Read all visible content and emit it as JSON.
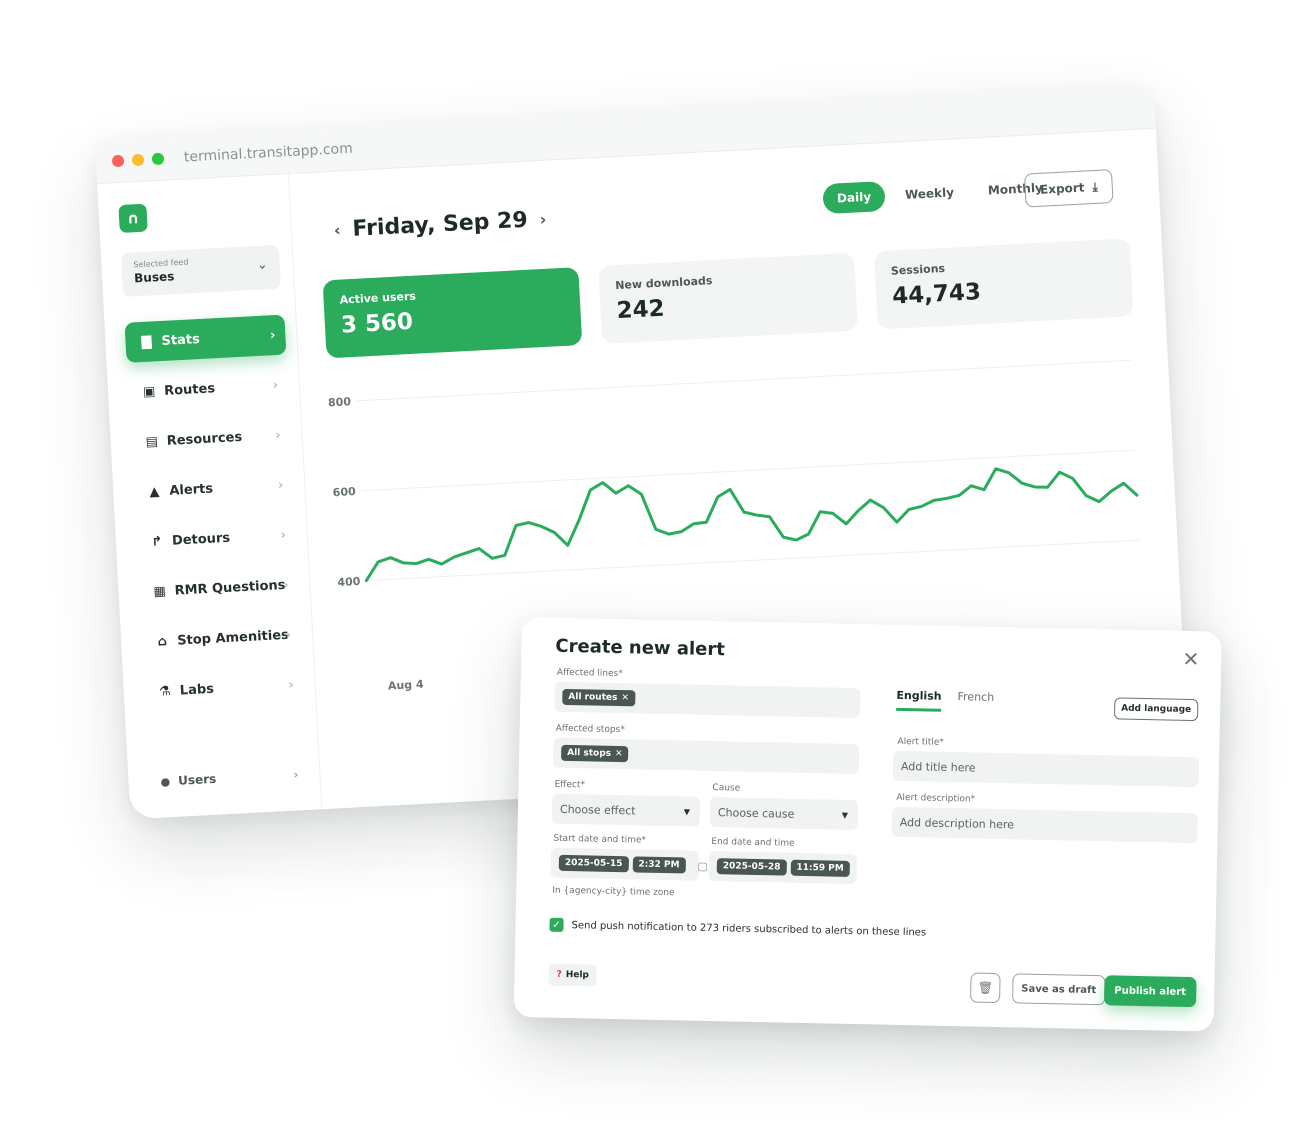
{
  "browser": {
    "url": "terminal.transitapp.com"
  },
  "sidebar": {
    "logo_glyph": "∩",
    "feed": {
      "label": "Selected feed",
      "value": "Buses"
    },
    "items": [
      {
        "label": "Stats",
        "icon": "bar-chart-icon",
        "glyph": "▇",
        "active": true
      },
      {
        "label": "Routes",
        "icon": "bus-icon",
        "glyph": "▣"
      },
      {
        "label": "Resources",
        "icon": "document-icon",
        "glyph": "▤"
      },
      {
        "label": "Alerts",
        "icon": "warning-icon",
        "glyph": "▲"
      },
      {
        "label": "Detours",
        "icon": "detour-arrow-icon",
        "glyph": "↱"
      },
      {
        "label": "RMR Questions",
        "icon": "questionnaire-icon",
        "glyph": "▦"
      },
      {
        "label": "Stop Amenities",
        "icon": "bench-icon",
        "glyph": "⌂"
      },
      {
        "label": "Labs",
        "icon": "flask-icon",
        "glyph": "⚗"
      }
    ],
    "users": {
      "label": "Users",
      "icon": "person-icon",
      "glyph": "●"
    }
  },
  "header": {
    "date": "Friday, Sep 29",
    "prev": "‹",
    "next": "›"
  },
  "periods": [
    "Daily",
    "Weekly",
    "Monthly"
  ],
  "active_period": "Daily",
  "export_label": "Export",
  "stats": [
    {
      "label": "Active users",
      "value": "3 560",
      "highlight": true
    },
    {
      "label": "New downloads",
      "value": "242"
    },
    {
      "label": "Sessions",
      "value": "44,743"
    }
  ],
  "chart_data": {
    "type": "line",
    "yticks": [
      400,
      600,
      800
    ],
    "ylim": [
      400,
      800
    ],
    "xtick_label": "Aug 4",
    "series_color": "#2aac5c",
    "values": [
      400,
      440,
      448,
      435,
      432,
      440,
      428,
      442,
      450,
      458,
      435,
      440,
      505,
      510,
      500,
      485,
      455,
      510,
      575,
      590,
      565,
      580,
      560,
      480,
      468,
      472,
      488,
      490,
      545,
      560,
      508,
      500,
      495,
      448,
      440,
      452,
      500,
      495,
      470,
      498,
      520,
      502,
      468,
      495,
      500,
      512,
      515,
      520,
      540,
      530,
      575,
      565,
      540,
      530,
      528,
      560,
      545,
      505,
      490,
      512,
      528,
      500
    ]
  },
  "modal": {
    "title": "Create new alert",
    "close_glyph": "✕",
    "affected_lines": {
      "label": "Affected lines*",
      "chip": "All routes"
    },
    "affected_stops": {
      "label": "Affected stops*",
      "chip": "All stops"
    },
    "effect": {
      "label": "Effect*",
      "placeholder": "Choose effect"
    },
    "cause": {
      "label": "Cause",
      "placeholder": "Choose cause"
    },
    "start": {
      "label": "Start date and time*",
      "date": "2025-05-15",
      "time": "2:32 PM"
    },
    "end": {
      "label": "End date and time",
      "date": "2025-05-28",
      "time": "11:59 PM"
    },
    "timezone_note": "In {agency-city} time zone",
    "languages": [
      "English",
      "French"
    ],
    "add_language": "Add language",
    "alert_title": {
      "label": "Alert title*",
      "placeholder": "Add title here"
    },
    "alert_description": {
      "label": "Alert description*",
      "placeholder": "Add description here"
    },
    "push_notification": "Send push notification to 273 riders subscribed to alerts on these lines",
    "help_label": "Help",
    "save_draft_label": "Save as draft",
    "publish_label": "Publish alert"
  }
}
